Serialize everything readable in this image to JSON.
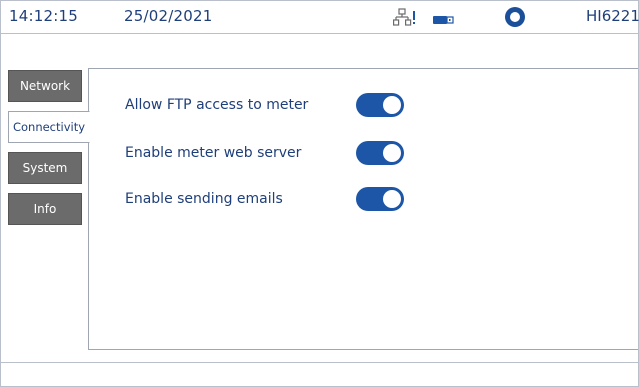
{
  "status_bar": {
    "time": "14:12:15",
    "date": "25/02/2021",
    "model": "HI6221",
    "icons": [
      "network-icon",
      "usb-icon",
      "record-icon"
    ]
  },
  "tabs": [
    {
      "label": "Network",
      "active": false
    },
    {
      "label": "Connectivity",
      "active": true
    },
    {
      "label": "System",
      "active": false
    },
    {
      "label": "Info",
      "active": false
    }
  ],
  "settings": [
    {
      "label": "Allow FTP access to meter",
      "enabled": true
    },
    {
      "label": "Enable meter web server",
      "enabled": true
    },
    {
      "label": "Enable sending emails",
      "enabled": true
    }
  ],
  "colors": {
    "accent": "#1d56a6",
    "text": "#1f3f7a",
    "tab_inactive": "#6b6b6b"
  }
}
